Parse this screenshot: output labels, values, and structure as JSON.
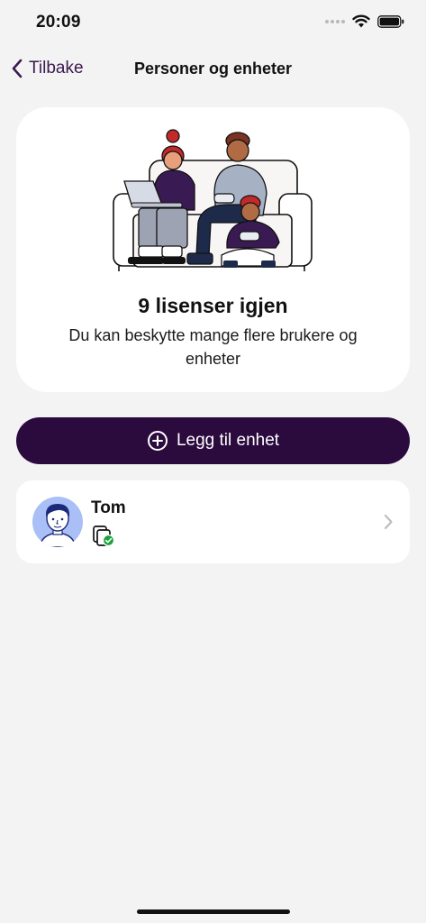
{
  "status_bar": {
    "time": "20:09",
    "icons": [
      "cellular-signal-icon",
      "wifi-icon",
      "battery-icon"
    ]
  },
  "nav": {
    "back_label": "Tilbake",
    "title": "Personer og enheter"
  },
  "hero": {
    "illustration": "family-on-couch-illustration",
    "title": "9 lisenser igjen",
    "subtitle": "Du kan beskytte mange flere brukere og enheter"
  },
  "actions": {
    "add_device_label": "Legg til enhet",
    "add_icon": "plus-circle-icon"
  },
  "people": [
    {
      "name": "Tom",
      "avatar": "person-avatar",
      "device_status": "device-protected-icon"
    }
  ],
  "colors": {
    "background": "#f4f3f4",
    "accent": "#2b0a3d",
    "back_link": "#3a1a4f",
    "avatar_bg": "#a9bff5",
    "status_ok": "#1aa33a"
  }
}
